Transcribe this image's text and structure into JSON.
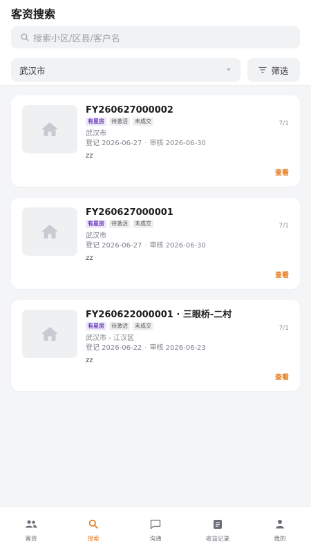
{
  "header": {
    "title": "客资搜索",
    "search_placeholder": "搜索小区/区县/客户名",
    "city": "武汉市",
    "filter_label": "筛选"
  },
  "cards": [
    {
      "title": "FY260627000002",
      "tags": [
        "有星房",
        "待激活",
        "未成交"
      ],
      "ratio": "7/1",
      "address": "武汉市",
      "reg_label": "登记 2026-06-27",
      "audit_label": "审核 2026-06-30",
      "note": "zz",
      "view_label": "查看"
    },
    {
      "title": "FY260627000001",
      "tags": [
        "有星房",
        "待激活",
        "未成交"
      ],
      "ratio": "7/1",
      "address": "武汉市",
      "reg_label": "登记 2026-06-27",
      "audit_label": "审核 2026-06-30",
      "note": "zz",
      "view_label": "查看"
    },
    {
      "title": "FY260622000001 · 三眼桥-二村",
      "tags": [
        "有星房",
        "待激活",
        "未成交"
      ],
      "ratio": "7/1",
      "address": "武汉市 - 江汉区",
      "reg_label": "登记 2026-06-22",
      "audit_label": "审核 2026-06-23",
      "note": "zz",
      "view_label": "查看"
    }
  ],
  "tabbar": {
    "items": [
      {
        "label": "客资",
        "icon": "users-icon",
        "active": false
      },
      {
        "label": "搜索",
        "icon": "search-icon",
        "active": true
      },
      {
        "label": "沟通",
        "icon": "chat-icon",
        "active": false
      },
      {
        "label": "收益记录",
        "icon": "document-icon",
        "active": false
      },
      {
        "label": "我的",
        "icon": "person-icon",
        "active": false
      }
    ]
  },
  "colors": {
    "accent": "#e67e22",
    "tag_primary_bg": "#ede7f8",
    "tag_primary_text": "#6a3fc0"
  }
}
